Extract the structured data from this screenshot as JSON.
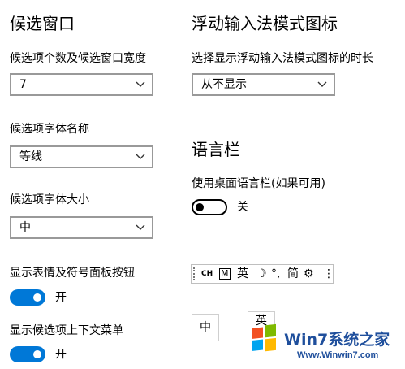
{
  "left": {
    "heading": "候选窗口",
    "count_width_label": "候选项个数及候选窗口宽度",
    "count_width_value": "7",
    "font_name_label": "候选项字体名称",
    "font_name_value": "等线",
    "font_size_label": "候选项字体大小",
    "font_size_value": "中",
    "emoji_label": "显示表情及符号面板按钮",
    "emoji_state": "开",
    "context_menu_label": "显示候选项上下文菜单",
    "context_menu_state": "开"
  },
  "right": {
    "heading": "浮动输入法模式图标",
    "float_label": "选择显示浮动输入法模式图标的时长",
    "float_value": "从不显示",
    "langbar_heading": "语言栏",
    "langbar_toggle_label": "使用桌面语言栏(如果可用)",
    "langbar_state": "关"
  },
  "langbar": {
    "ch": "CH",
    "mode_glyph": "M",
    "lang": "英",
    "moon": "☽",
    "punct": "°,",
    "simplified": "简",
    "gear": "⚙",
    "more": "⋮"
  },
  "candidates": {
    "zh_box": "中",
    "en_box": "英"
  },
  "watermark": {
    "brand": "Win7系统之家",
    "url": "Www.Winwin7.com"
  },
  "colors": {
    "accent": "#0078d7",
    "border": "#999999"
  },
  "icons": {
    "chevron": "chevron-down-icon",
    "gear": "gear-icon"
  }
}
